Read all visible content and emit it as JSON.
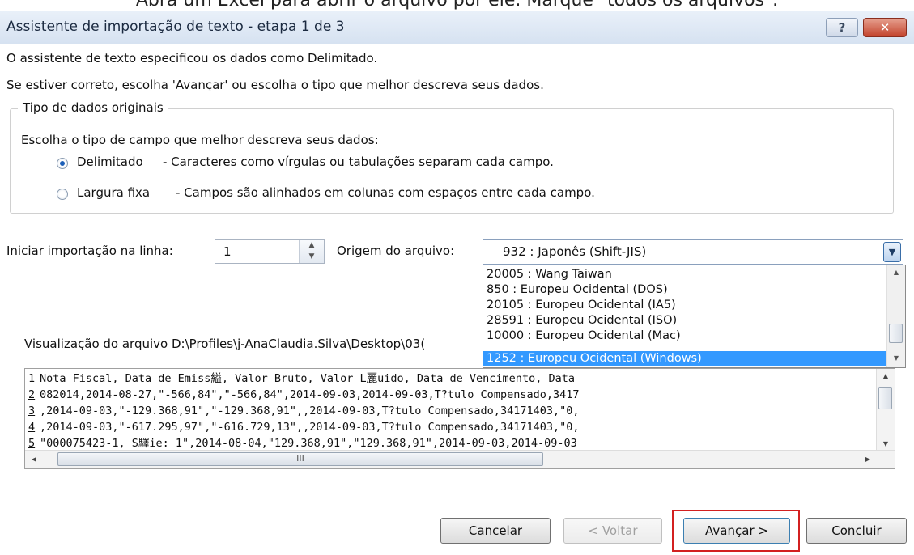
{
  "caption": "Abra um Excel para abrir o arquivo por ele. Marque \"todos os arquivos\".",
  "window": {
    "title": "Assistente de importação de texto - etapa 1 de 3",
    "help_icon": "question-mark-icon",
    "close_icon": "close-x-icon"
  },
  "intro": {
    "line1": "O assistente de texto especificou os dados como Delimitado.",
    "line2": "Se estiver correto, escolha 'Avançar' ou escolha o tipo que melhor descreva seus dados."
  },
  "data_type_group": {
    "legend": "Tipo de dados originais",
    "prompt": "Escolha o tipo de campo que melhor descreva seus dados:",
    "options": [
      {
        "label": "Delimitado",
        "description": "- Caracteres como vírgulas ou tabulações separam cada campo.",
        "selected": true
      },
      {
        "label": "Largura fixa",
        "description": "- Campos são alinhados em colunas com espaços entre cada campo.",
        "selected": false
      }
    ]
  },
  "start_row": {
    "label": "Iniciar importação na linha:",
    "value": "1"
  },
  "file_origin": {
    "label": "Origem do arquivo:",
    "value": "932 : Japonês (Shift-JIS)",
    "options": [
      "20005 : Wang Taiwan",
      " 850 : Europeu Ocidental (DOS)",
      "20105 : Europeu Ocidental (IA5)",
      "28591 : Europeu Ocidental (ISO)",
      "10000 : Europeu Ocidental (Mac)",
      " 1252 : Europeu Ocidental (Windows)"
    ],
    "highlighted_index": 5,
    "highlight_color": "#3399ff"
  },
  "preview": {
    "label": "Visualização do arquivo D:\\Profiles\\j-AnaClaudia.Silva\\Desktop\\03(",
    "lines": [
      {
        "n": "1",
        "text": "Nota Fiscal, Data de Emiss縊, Valor Bruto, Valor L麗uido, Data de Vencimento, Data"
      },
      {
        "n": "2",
        "text": "082014,2014-08-27,\"-566,84\",\"-566,84\",2014-09-03,2014-09-03,T?tulo Compensado,3417"
      },
      {
        "n": "3",
        "text": ",2014-09-03,\"-129.368,91\",\"-129.368,91\",,2014-09-03,T?tulo Compensado,34171403,\"0,"
      },
      {
        "n": "4",
        "text": ",2014-09-03,\"-617.295,97\",\"-616.729,13\",,2014-09-03,T?tulo Compensado,34171403,\"0,"
      },
      {
        "n": "5",
        "text": "\"000075423-1, S驛ie: 1\",2014-08-04,\"129.368,91\",\"129.368,91\",2014-09-03,2014-09-03"
      }
    ],
    "hscroll_grip": "III"
  },
  "buttons": {
    "cancel": "Cancelar",
    "back": "< Voltar",
    "next": "Avançar >",
    "finish": "Concluir"
  },
  "colors": {
    "highlight_border": "#d32020",
    "radio_selected": "#1c5fb8"
  }
}
